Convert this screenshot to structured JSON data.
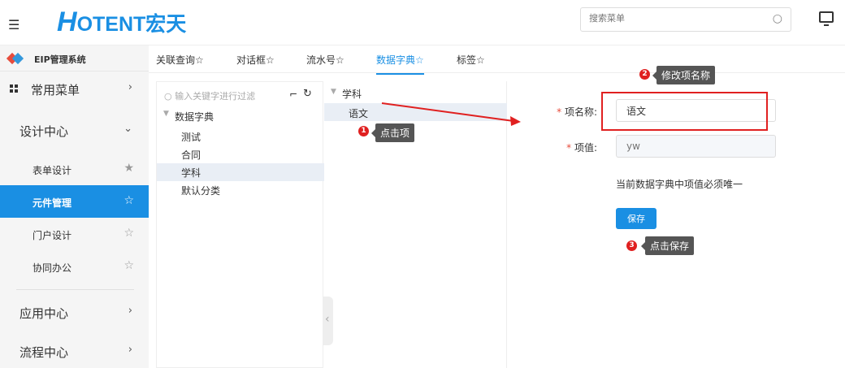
{
  "header": {
    "logo_h": "H",
    "logo_rest": "OTENT宏天",
    "search_placeholder": "搜索菜单"
  },
  "sidebar": {
    "system_name": "EIP管理系统",
    "items": [
      {
        "label": "常用菜单",
        "arrow": "›"
      },
      {
        "label": "设计中心",
        "arrow": "⌄"
      },
      {
        "label": "应用中心",
        "arrow": "›"
      },
      {
        "label": "流程中心",
        "arrow": "›"
      }
    ],
    "sub_items": [
      {
        "label": "表单设计",
        "star": "★"
      },
      {
        "label": "元件管理",
        "star": "☆"
      },
      {
        "label": "门户设计",
        "star": "☆"
      },
      {
        "label": "协同办公",
        "star": "☆"
      }
    ]
  },
  "tabs": [
    "关联查询☆",
    "对话框☆",
    "流水号☆",
    "数据字典☆",
    "标签☆"
  ],
  "tree": {
    "filter_placeholder": "输入关键字进行过滤",
    "root": "数据字典",
    "children": [
      "测试",
      "合同",
      "学科",
      "默认分类"
    ]
  },
  "list": {
    "root": "学科",
    "children": [
      "语文"
    ]
  },
  "form": {
    "name_label": "项名称:",
    "name_value": "语文",
    "value_label": "项值:",
    "value_placeholder": "yw",
    "hint": "当前数据字典中项值必须唯一",
    "save_label": "保存"
  },
  "annotations": [
    {
      "num": "1",
      "text": "点击项"
    },
    {
      "num": "2",
      "text": "修改项名称"
    },
    {
      "num": "3",
      "text": "点击保存"
    }
  ],
  "colors": {
    "accent": "#1a8fe3",
    "annotation": "#e02020"
  }
}
